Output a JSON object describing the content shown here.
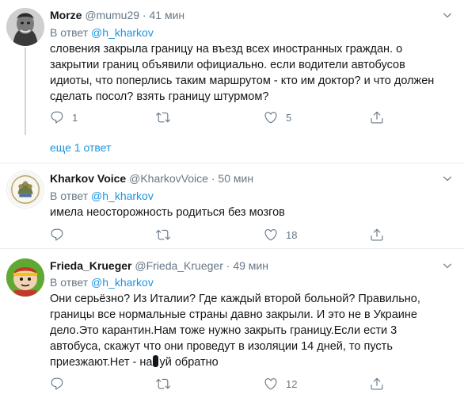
{
  "tweets": [
    {
      "display_name": "Morze",
      "handle": "@mumu29",
      "separator": "·",
      "time": "41 мин",
      "reply_prefix": "В ответ",
      "reply_to": "@h_kharkov",
      "text": "словения закрыла границу на въезд всех иностранных граждан. о закрытии границ объявили официально. если водители автобусов идиоты, что поперлись таким маршрутом - кто им доктор? и что должен сделать посол? взять границу штурмом?",
      "reply_count": "1",
      "retweet_count": "",
      "like_count": "5"
    },
    {
      "display_name": "Kharkov Voice",
      "handle": "@KharkovVoice",
      "separator": "·",
      "time": "50 мин",
      "reply_prefix": "В ответ",
      "reply_to": "@h_kharkov",
      "text": "имела неосторожность родиться без мозгов",
      "reply_count": "",
      "retweet_count": "",
      "like_count": "18"
    },
    {
      "display_name": "Frieda_Krueger",
      "handle": "@Frieda_Krueger",
      "separator": "·",
      "time": "49 мин",
      "reply_prefix": "В ответ",
      "reply_to": "@h_kharkov",
      "text_before_censor": "Они серьёзно? Из Италии? Где каждый второй больной? Правильно, границы все нормальные страны давно закрыли. И это не в Украине дело.Это карантин.Нам тоже нужно закрыть границу.Если ести 3 автобуса, скажут что они проведут в изоляции 14 дней, то пусть приезжают.Нет - на",
      "text_after_censor": "уй обратно",
      "reply_count": "",
      "retweet_count": "",
      "like_count": "12"
    }
  ],
  "show_more_replies": "еще 1 ответ",
  "icons": {
    "reply": "reply-icon",
    "retweet": "retweet-icon",
    "like": "heart-icon",
    "share": "share-icon",
    "caret": "chevron-down-icon"
  },
  "colors": {
    "link": "#1b95e0",
    "muted": "#657786",
    "divider": "#e6ecf0"
  }
}
